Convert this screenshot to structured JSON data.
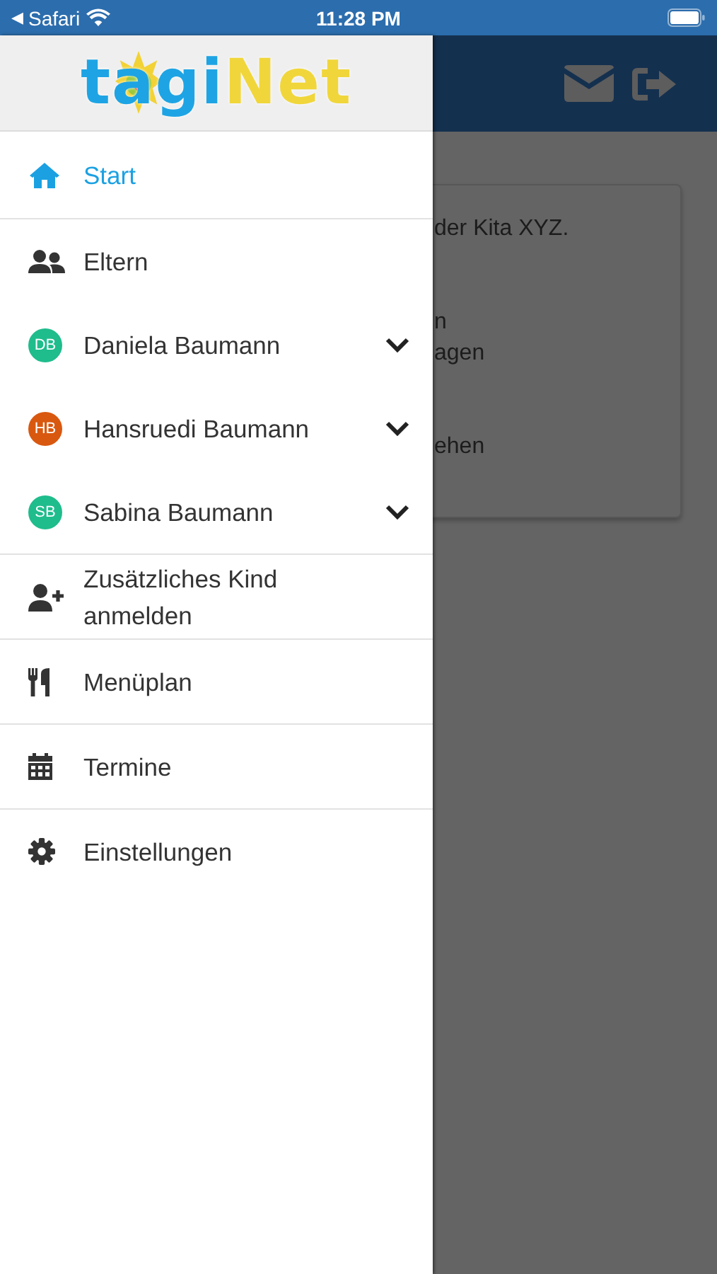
{
  "status_bar": {
    "back_arrow": "◀",
    "app": "Safari",
    "time": "11:28 PM"
  },
  "logo": {
    "text": "tagiNet"
  },
  "drawer": {
    "sections": [
      [
        {
          "kind": "home",
          "label": "Start",
          "selected": true
        }
      ],
      [
        {
          "kind": "people",
          "label": "Eltern",
          "selected": false
        },
        {
          "kind": "avatar",
          "initials": "DB",
          "color": "#1fbc8c",
          "label": "Daniela Baumann",
          "selected": false,
          "expanded": false
        },
        {
          "kind": "avatar",
          "initials": "HB",
          "color": "#d9580f",
          "label": "Hansruedi Baumann",
          "selected": false,
          "expanded": false
        },
        {
          "kind": "avatar",
          "initials": "SB",
          "color": "#1fbc8c",
          "label": "Sabina Baumann",
          "selected": false,
          "expanded": false
        }
      ],
      [
        {
          "kind": "add-person",
          "label": "Zusätzliches Kind anmelden",
          "selected": false
        }
      ],
      [
        {
          "kind": "cutlery",
          "label": "Menüplan",
          "selected": false
        }
      ],
      [
        {
          "kind": "calendar",
          "label": "Termine",
          "selected": false
        }
      ],
      [
        {
          "kind": "gear",
          "label": "Einstellungen",
          "selected": false
        }
      ]
    ]
  },
  "background_card": {
    "paragraphs": [
      [
        "der Kita XYZ."
      ],
      [
        "n",
        "agen"
      ],
      [
        "ehen"
      ]
    ]
  }
}
